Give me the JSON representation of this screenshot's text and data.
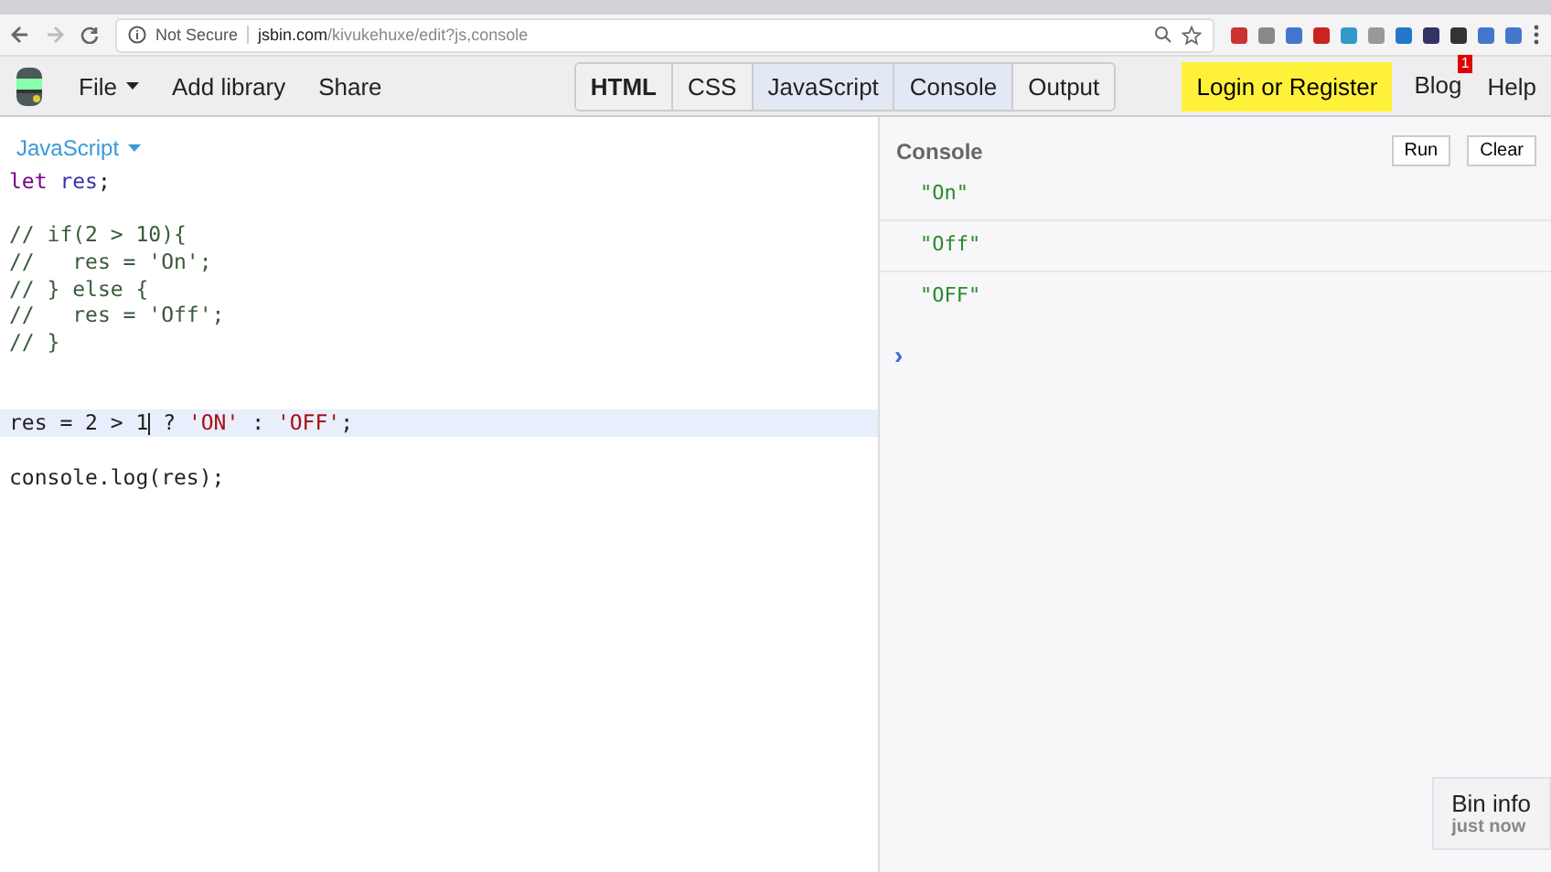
{
  "browser": {
    "security": "Not Secure",
    "url_domain": "jsbin.com",
    "url_path": "/kivukehuxe/edit?js,console"
  },
  "toolbar": {
    "menus": [
      {
        "label": "File",
        "dropdown": true
      },
      {
        "label": "Add library",
        "dropdown": false
      },
      {
        "label": "Share",
        "dropdown": false
      }
    ],
    "panels": [
      {
        "label": "HTML",
        "selected": false
      },
      {
        "label": "CSS",
        "selected": false
      },
      {
        "label": "JavaScript",
        "selected": true
      },
      {
        "label": "Console",
        "selected": true
      },
      {
        "label": "Output",
        "selected": false
      }
    ],
    "login": "Login or Register",
    "blog": "Blog",
    "blog_badge": "1",
    "help": "Help"
  },
  "editor": {
    "language": "JavaScript",
    "lines": [
      {
        "highlighted": false,
        "tokens": [
          {
            "kind": "keyword",
            "text": "let"
          },
          {
            "kind": "variable",
            "text": " res"
          },
          {
            "kind": "plain",
            "text": ";"
          }
        ]
      },
      {
        "kind": "blank"
      },
      {
        "highlighted": false,
        "tokens": [
          {
            "kind": "comment",
            "text": "// if(2 > 10){"
          }
        ]
      },
      {
        "highlighted": false,
        "tokens": [
          {
            "kind": "comment",
            "text": "//   res = 'On';"
          }
        ]
      },
      {
        "highlighted": false,
        "tokens": [
          {
            "kind": "comment",
            "text": "// } else {"
          }
        ]
      },
      {
        "highlighted": false,
        "tokens": [
          {
            "kind": "comment",
            "text": "//   res = 'Off';"
          }
        ]
      },
      {
        "highlighted": false,
        "tokens": [
          {
            "kind": "comment",
            "text": "// }"
          }
        ]
      },
      {
        "kind": "blank"
      },
      {
        "kind": "blank"
      },
      {
        "highlighted": true,
        "tokens": [
          {
            "kind": "plain",
            "text": "res = 2 > 1",
            "caret": true
          },
          {
            "kind": "plain",
            "text": " ? "
          },
          {
            "kind": "string",
            "text": "'ON'"
          },
          {
            "kind": "plain",
            "text": " : "
          },
          {
            "kind": "string",
            "text": "'OFF'"
          },
          {
            "kind": "plain",
            "text": ";"
          }
        ]
      },
      {
        "kind": "blank"
      },
      {
        "highlighted": false,
        "tokens": [
          {
            "kind": "plain",
            "text": "console.log(res);"
          }
        ]
      }
    ]
  },
  "console": {
    "title": "Console",
    "run": "Run",
    "clear": "Clear",
    "outputs": [
      "\"On\"",
      "\"Off\"",
      "\"OFF\""
    ],
    "prompt": "›"
  },
  "bin_info": {
    "title": "Bin info",
    "time": "just now"
  }
}
